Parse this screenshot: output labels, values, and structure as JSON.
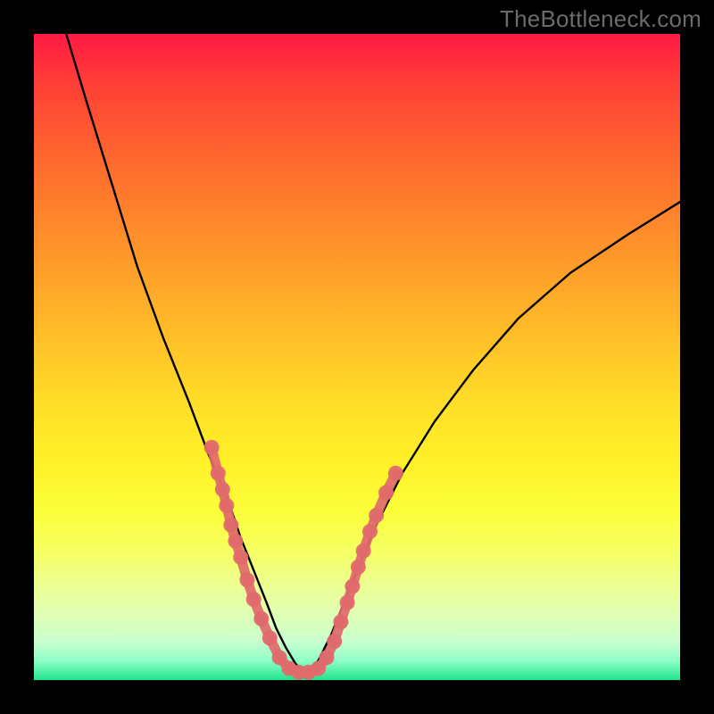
{
  "watermark": "TheBottleneck.com",
  "chart_data": {
    "type": "line",
    "title": "",
    "xlabel": "",
    "ylabel": "",
    "xlim": [
      0,
      100
    ],
    "ylim": [
      0,
      100
    ],
    "series": [
      {
        "name": "bottleneck-curve-left",
        "x": [
          5,
          8,
          12,
          16,
          20,
          24,
          27,
          30,
          32,
          34,
          36,
          37.5,
          39,
          40.5,
          42
        ],
        "y": [
          100,
          90,
          77,
          64,
          53,
          43,
          35,
          28,
          22,
          17,
          12,
          8,
          5,
          2.5,
          1
        ]
      },
      {
        "name": "bottleneck-curve-right",
        "x": [
          42,
          44,
          46,
          48,
          50,
          53,
          57,
          62,
          68,
          75,
          83,
          92,
          100
        ],
        "y": [
          1,
          3,
          7,
          12,
          17,
          24,
          32,
          40,
          48,
          56,
          63,
          69,
          74
        ]
      }
    ],
    "band": {
      "name": "bottleneck-band",
      "points": [
        {
          "x": 27.5,
          "y": 36
        },
        {
          "x": 28.5,
          "y": 32
        },
        {
          "x": 29.2,
          "y": 29.5
        },
        {
          "x": 29.8,
          "y": 27
        },
        {
          "x": 30.5,
          "y": 24
        },
        {
          "x": 31.2,
          "y": 21.5
        },
        {
          "x": 32.0,
          "y": 19
        },
        {
          "x": 33.0,
          "y": 15.5
        },
        {
          "x": 34.0,
          "y": 12.5
        },
        {
          "x": 35.2,
          "y": 9.5
        },
        {
          "x": 36.5,
          "y": 6.5
        },
        {
          "x": 38.0,
          "y": 3.5
        },
        {
          "x": 39.5,
          "y": 1.8
        },
        {
          "x": 41.0,
          "y": 1.2
        },
        {
          "x": 42.5,
          "y": 1.2
        },
        {
          "x": 44.0,
          "y": 1.8
        },
        {
          "x": 45.3,
          "y": 3.5
        },
        {
          "x": 46.5,
          "y": 6.0
        },
        {
          "x": 47.5,
          "y": 9.0
        },
        {
          "x": 48.5,
          "y": 12.0
        },
        {
          "x": 49.3,
          "y": 14.5
        },
        {
          "x": 50.2,
          "y": 17.5
        },
        {
          "x": 51.0,
          "y": 20
        },
        {
          "x": 52.0,
          "y": 23
        },
        {
          "x": 53.0,
          "y": 25.5
        },
        {
          "x": 54.5,
          "y": 29
        },
        {
          "x": 56.0,
          "y": 32
        }
      ]
    },
    "colors": {
      "curve": "#000000",
      "band": "#e06a6c",
      "gradient_top": "#ff1a43",
      "gradient_bottom": "#20e48e"
    }
  }
}
